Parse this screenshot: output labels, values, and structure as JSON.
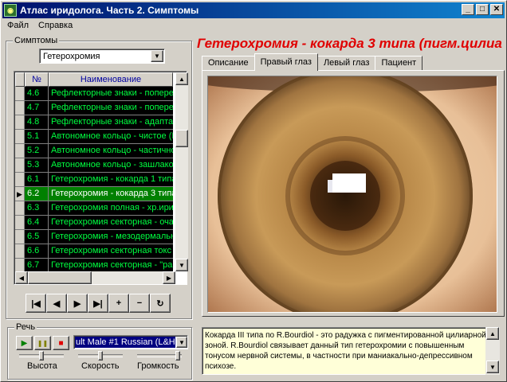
{
  "window": {
    "title": "Атлас иридолога. Часть 2. Симптомы",
    "minimize": "_",
    "maximize": "□",
    "close": "✕"
  },
  "menu": [
    "Файл",
    "Справка"
  ],
  "symptoms": {
    "group_label": "Симптомы",
    "selected_category": "Гетерохромия",
    "grid": {
      "headers": [
        "№",
        "Наименование"
      ],
      "rows": [
        {
          "num": "4.6",
          "name": "Рефлекторные знаки - попере"
        },
        {
          "num": "4.7",
          "name": "Рефлекторные знаки - попере"
        },
        {
          "num": "4.8",
          "name": "Рефлекторные знаки - адаптац"
        },
        {
          "num": "5.1",
          "name": "Автономное кольцо - чистое (I"
        },
        {
          "num": "5.2",
          "name": "Автономное кольцо - частично"
        },
        {
          "num": "5.3",
          "name": "Автономное кольцо - зашлако"
        },
        {
          "num": "6.1",
          "name": "Гетерохромия - кокарда 1 типа"
        },
        {
          "num": "6.2",
          "name": "Гетерохромия - кокарда 3 типа"
        },
        {
          "num": "6.3",
          "name": "Гетерохромия полная - хр.ирид"
        },
        {
          "num": "6.4",
          "name": "Гетерохромия секторная - оча"
        },
        {
          "num": "6.5",
          "name": "Гетерохромия - мезодермальн"
        },
        {
          "num": "6.6",
          "name": "Гетерохромия секторная токс"
        },
        {
          "num": "6.7",
          "name": "Гетерохромия секторная - \"ра"
        }
      ],
      "current_row_marker": "▶"
    },
    "navigator": [
      "|◀",
      "◀",
      "▶",
      "▶|",
      "+",
      "−",
      "↻"
    ]
  },
  "heading": "Гетерохромия - кокарда 3 типа (пигм.цилиа",
  "tabs": [
    "Описание",
    "Правый глаз",
    "Левый глаз",
    "Пациент"
  ],
  "active_tab": "Правый глаз",
  "speech": {
    "group_label": "Речь",
    "play": "▶",
    "pause": "❚❚",
    "stop": "■",
    "voice": "ult Male #1 Russian (L&H)",
    "sliders": [
      {
        "label": "Высота",
        "level": 0.5
      },
      {
        "label": "Скорость",
        "level": 0.5
      },
      {
        "label": "Громкость",
        "level": 0.9
      }
    ]
  },
  "description": "Кокарда III типа по R.Bourdiol - это радужка с пигментированной цилиарной зоной. R.Bourdiol связывает данный тип гетерохромии с повышенным тонусом нервной системы, в частности при маниакально-депрессивном психозе.",
  "colors": {
    "title_start": "#00106b",
    "title_end": "#1084d0",
    "grid_text": "#00ff40",
    "heading": "#e00000",
    "desc_bg": "#ffffd8"
  }
}
